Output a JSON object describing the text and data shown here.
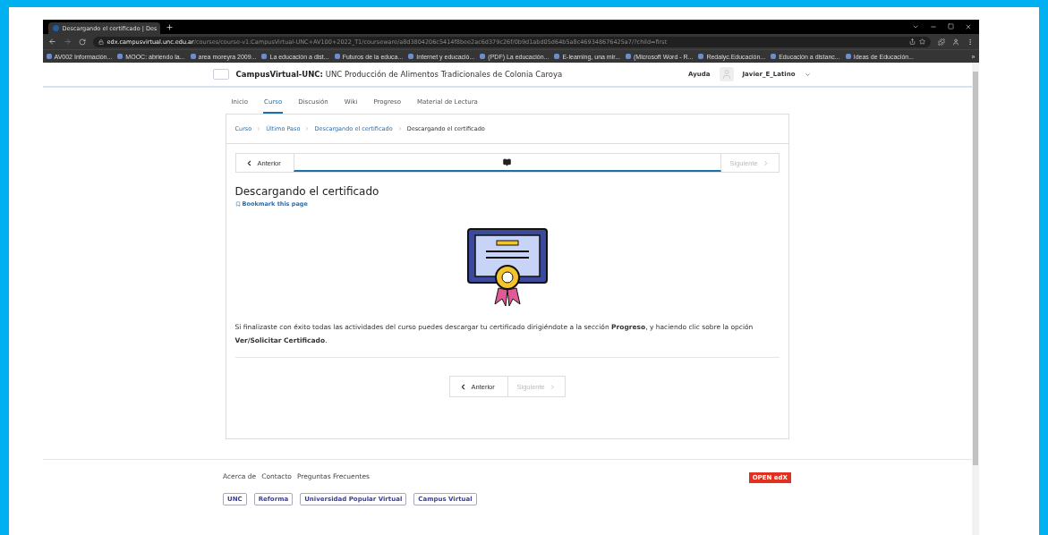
{
  "browser": {
    "tab_title": "Descargando el certificado | Des",
    "url_host": "edx.campusvirtual.unc.edu.ar",
    "url_path": "/courses/course-v1:CampusVirtual-UNC+AV100+2022_T1/courseware/a8d3804206c5414f8bee2ac6d379c26f/0b9d1abd05d64b5a8c469348676425a7/?child=first",
    "bookmarks": [
      "AV002 Información...",
      "MOOC: abriendo la...",
      "area moreyra 2009...",
      "La educación a dist...",
      "Futuros de la educa...",
      "Internet y educació...",
      "(PDF) La educación...",
      "E-learning, una mir...",
      "(Microsoft Word - R...",
      "Redalyc.Educación...",
      "Educación a distanc...",
      "Ideas de Educación..."
    ],
    "more": "»"
  },
  "header": {
    "org": "CampusVirtual-UNC:",
    "course": "UNC Producción de Alimentos Tradicionales de Colonia Caroya",
    "help": "Ayuda",
    "user": "Javier_E_Latino"
  },
  "tabs": [
    {
      "label": "Inicio",
      "selected": false
    },
    {
      "label": "Curso",
      "selected": true
    },
    {
      "label": "Discusión",
      "selected": false
    },
    {
      "label": "Wiki",
      "selected": false
    },
    {
      "label": "Progreso",
      "selected": false
    },
    {
      "label": "Material de Lectura",
      "selected": false
    }
  ],
  "breadcrumbs": [
    {
      "label": "Curso",
      "link": true
    },
    {
      "label": "Último Paso",
      "link": true
    },
    {
      "label": "Descargando el certificado",
      "link": true
    },
    {
      "label": "Descargando el certificado",
      "link": false
    }
  ],
  "sequence": {
    "previous": {
      "label": "Anterior",
      "disabled": false
    },
    "next": {
      "label": "Siguiente",
      "disabled": true
    }
  },
  "unit": {
    "title": "Descargando el certificado",
    "bookmark": "Bookmark this page",
    "body": "Si finalizaste con éxito todas las actividades del curso puedes descargar tu certificado dirigiéndote a la sección **Progreso**, y haciendo clic sobre la opción **Ver/Solicitar Certificado**."
  },
  "bottom_nav": {
    "previous": {
      "label": "Anterior",
      "disabled": false
    },
    "next": {
      "label": "Siguiente",
      "disabled": true
    }
  },
  "footer": {
    "links": [
      "Acerca de",
      "Contacto",
      "Preguntas Frecuentes"
    ],
    "logos": [
      "UNC",
      "Reforma",
      "Universidad Popular Virtual",
      "Campus Virtual"
    ],
    "powered": "OPEN edX"
  }
}
